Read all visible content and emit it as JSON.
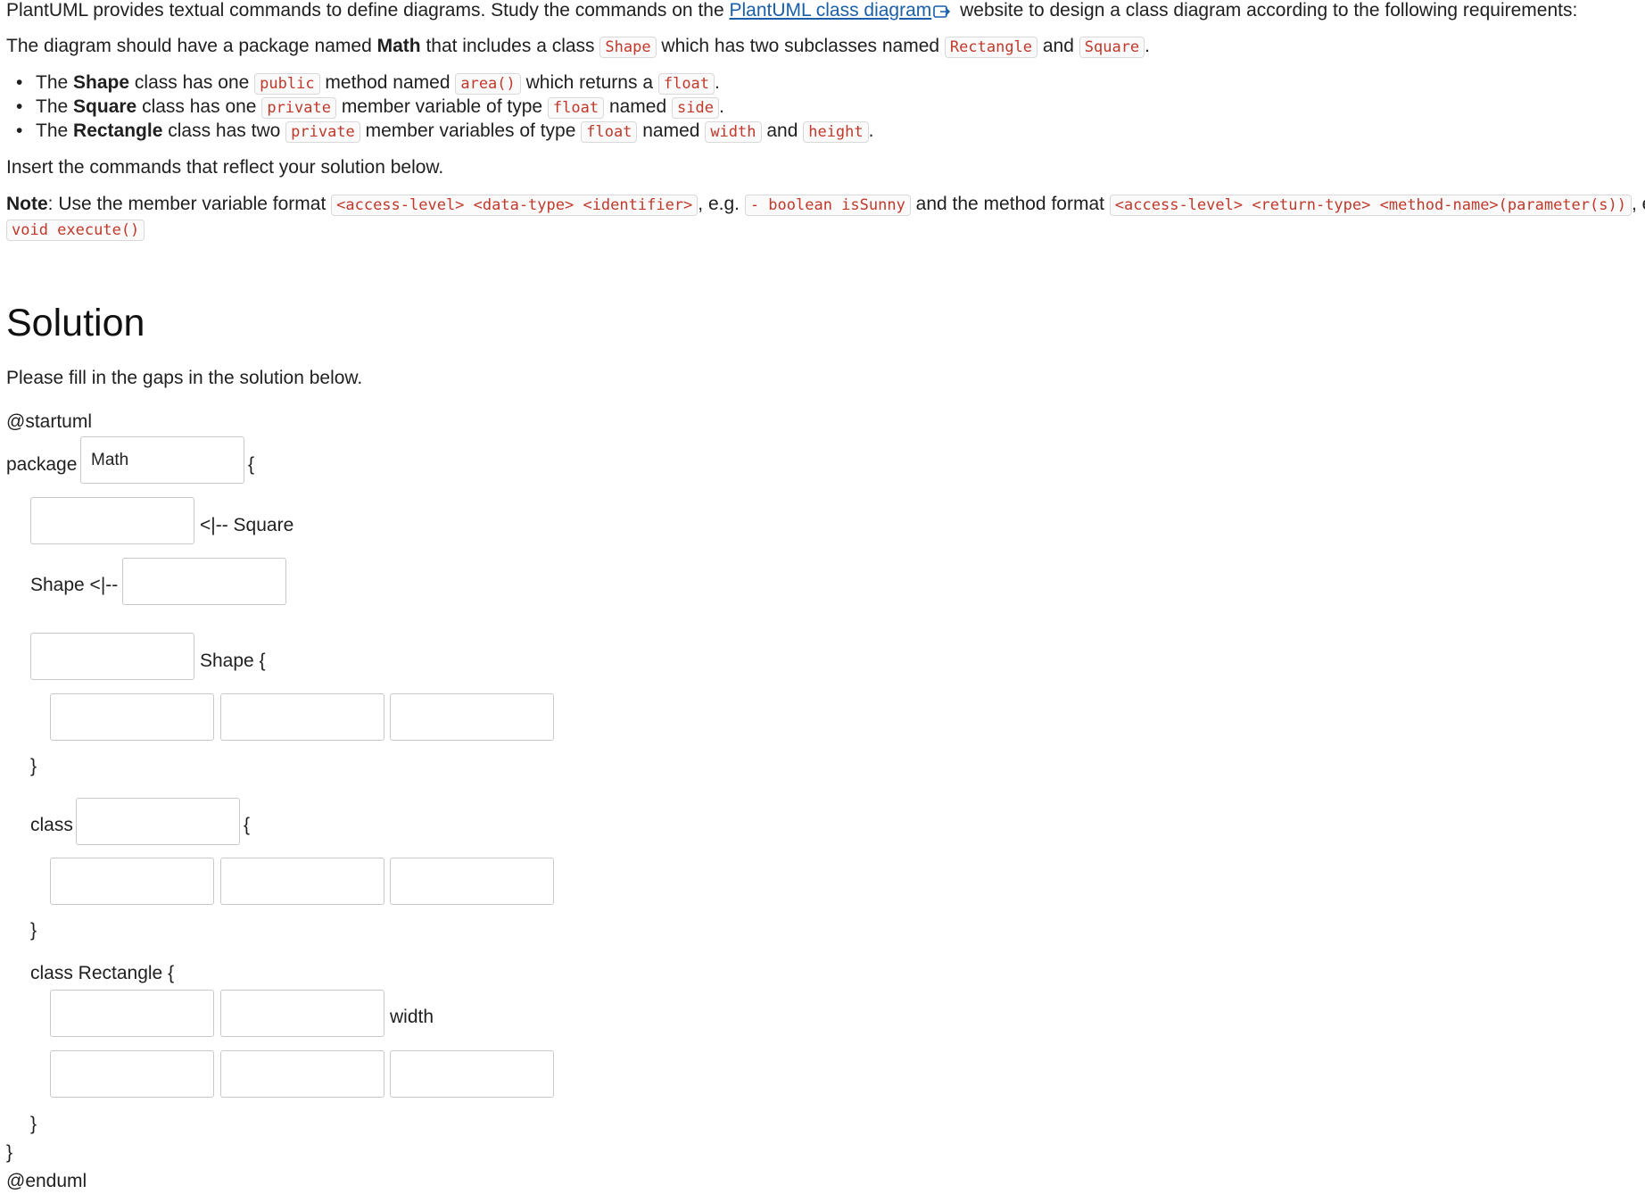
{
  "intro": {
    "p1_before": "PlantUML provides textual commands to define diagrams. Study the commands on the ",
    "p1_link": "PlantUML class diagram",
    "p1_after": " website to design a class diagram according to the following requirements:",
    "p2_a": "The diagram should have a package named ",
    "p2_bold": "Math",
    "p2_b": " that includes a class ",
    "p2_code1": "Shape",
    "p2_c": " which has two subclasses named ",
    "p2_code2": "Rectangle",
    "p2_d": " and ",
    "p2_code3": "Square",
    "p2_e": "."
  },
  "requirements": [
    {
      "a": "The ",
      "b": "Shape",
      "c": " class has one ",
      "code1": "public",
      "d": " method named ",
      "code2": "area()",
      "e": " which returns a ",
      "code3": "float",
      "f": "."
    },
    {
      "a": "The ",
      "b": "Square",
      "c": " class has one ",
      "code1": "private",
      "d": " member variable of type ",
      "code2": "float",
      "e": " named ",
      "code3": "side",
      "f": "."
    },
    {
      "a": "The ",
      "b": "Rectangle",
      "c": " class has two ",
      "code1": "private",
      "d": " member variables of type ",
      "code2": "float",
      "e": " named ",
      "code3": "width",
      "f": " and ",
      "code4": "height",
      "g": "."
    }
  ],
  "insert_text": "Insert the commands that reflect your solution below.",
  "note": {
    "bold": "Note",
    "a": ": Use the member variable format ",
    "code1": "<access-level> <data-type> <identifier>",
    "b": ", e.g. ",
    "code2": "- boolean isSunny",
    "c": " and the method format ",
    "code3": "<access-level> <return-type> <method-name>(parameter(s))",
    "d": ", e.g. ",
    "code4": "+",
    "code5": "void execute()"
  },
  "solution": {
    "heading": "Solution",
    "instruction": "Please fill in the gaps in the solution below.",
    "startuml": "@startuml",
    "package_kw": "package",
    "package_value": "Math",
    "open_brace": "{",
    "close_brace": "}",
    "inherit_square": "<|-- Square",
    "shape_inherit": "Shape <|--",
    "shape_open": "Shape {",
    "class_kw": "class",
    "class_rectangle": "class Rectangle {",
    "width_text": "width",
    "enduml": "@enduml"
  }
}
